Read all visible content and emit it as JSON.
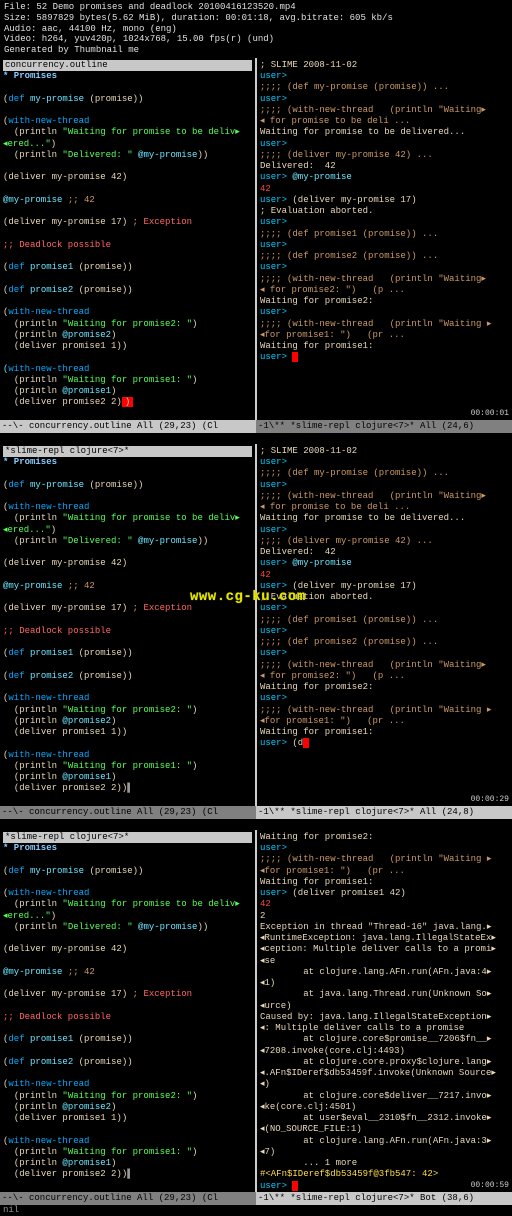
{
  "header": {
    "l1": "File: 52 Demo promises and deadlock 20100416123520.mp4",
    "l2": "Size: 5897829 bytes(5.62 MiB), duration: 00:01:18, avg.bitrate: 605 kb/s",
    "l3": "Audio: aac, 44100 Hz, mono (eng)",
    "l4": "Video: h264, yuv420p, 1024x768, 15.00 fps(r) (und)",
    "l5": "Generated by Thumbnail me"
  },
  "watermark": "www.cg-ku.com",
  "frame1": {
    "left_title": " concurrency.outline",
    "right_title": "; SLIME 2008-11-02",
    "left_mode": "--\\-   concurrency.outline   All (29,23)   (Cl",
    "right_mode": "-1\\**  *slime-repl clojure<7>*   All (24,6)",
    "right": {
      "l1": "user> ",
      "l2": ";;;; (def my-promise (promise)) ...",
      "l3": "user> ",
      "l4": ";;;; (with-new-thread   (println \"Waiting▸",
      "l5": "◂ for promise to be deli ...",
      "l6": "Waiting for promise to be delivered...",
      "l7": "user> ",
      "l8": ";;;; (deliver my-promise 42) ...",
      "l9": "Delivered:  42",
      "l10": "user> @my-promise",
      "l11": "42",
      "l12": "user> (deliver my-promise 17)",
      "l13": "; Evaluation aborted.",
      "l14": "user> ",
      "l15": ";;;; (def promise1 (promise)) ...",
      "l16": "user> ",
      "l17": ";;;; (def promise2 (promise)) ...",
      "l18": "user> ",
      "l19": ";;;; (with-new-thread   (println \"Waiting▸",
      "l20": "◂ for promise2: \")   (p ...",
      "l21": "Waiting for promise2: ",
      "l22": "user> ",
      "l23": ";;;; (with-new-thread   (println \"Waiting ▸",
      "l24": "◂for promise1: \")   (pr ...",
      "l25": "Waiting for promise1: ",
      "l26": "user> "
    },
    "ts": "00:00:01"
  },
  "frame2": {
    "left_title": " *slime-repl clojure<7>*",
    "ts": "00:00:29",
    "left_mode": "--\\-   concurrency.outline   All (29,23)   (Cl",
    "right_mode": "-1\\**  *slime-repl clojure<7>*   All (24,8)",
    "right": {
      "l26": "user> (d"
    }
  },
  "frame3": {
    "left_title": " *slime-repl clojure<7>*",
    "ts": "00:00:59",
    "left_mode": "--\\-   concurrency.outline   All (29,23)   (Cl",
    "right_mode": "-1\\**  *slime-repl clojure<7>*   Bot (38,6)",
    "right": {
      "l1": "Waiting for promise2: ",
      "l2": "user> ",
      "l3": ";;;; (with-new-thread   (println \"Waiting ▸",
      "l4": "◂for promise1: \")   (pr ...",
      "l5": "Waiting for promise1: ",
      "l6": "user> (deliver promise1 42)",
      "l7": "42",
      "l8": "2",
      "l9": "Exception in thread \"Thread-16\" java.lang.▸",
      "l10": "◂RuntimeException: java.lang.IllegalStateEx▸",
      "l11": "◂ception: Multiple deliver calls to a promi▸",
      "l12": "◂se",
      "l13": "        at clojure.lang.AFn.run(AFn.java:4▸",
      "l14": "◂1)",
      "l15": "        at java.lang.Thread.run(Unknown So▸",
      "l16": "◂urce)",
      "l17": "Caused by: java.lang.IllegalStateException▸",
      "l18": "◂: Multiple deliver calls to a promise",
      "l19": "        at clojure.core$promise__7206$fn__▸",
      "l20": "◂7208.invoke(core.clj:4493)",
      "l21": "        at clojure.core.proxy$clojure.lang▸",
      "l22": "◂.AFn$IDeref$db53459f.invoke(Unknown Source▸",
      "l23": "◂)",
      "l24": "        at clojure.core$deliver__7217.invo▸",
      "l25": "◂ke(core.clj:4501)",
      "l26": "        at user$eval__2310$fn__2312.invoke▸",
      "l27": "◂(NO_SOURCE_FILE:1)",
      "l28": "        at clojure.lang.AFn.run(AFn.java:3▸",
      "l29": "◂7)",
      "l30": "        ... 1 more",
      "l31": "#<AFn$IDeref$db53459f@3fb547: 42>",
      "l32": "user> "
    }
  },
  "left_code": {
    "heading": "* Promises",
    "l1": "(def my-promise (promise))",
    "l2": "(with-new-thread",
    "l3": "  (println \"Waiting for promise to be deliv▸",
    "l3b": "◂ered...\")",
    "l4": "  (println \"Delivered: \" @my-promise))",
    "l5": "(deliver my-promise 42)",
    "l6": "@my-promise ;; 42",
    "l7": "(deliver my-promise 17) ;",
    "l7b": "Exception",
    "l8": ";; Deadlock possible",
    "l9": "(def promise1 (promise))",
    "l10": "(def promise2 (promise))",
    "l11": "(with-new-thread",
    "l12": "  (println \"Waiting for promise2: \")",
    "l13": "  (println @promise2)",
    "l14": "  (deliver promise1 1))",
    "l15": "(with-new-thread",
    "l16": "  (println \"Waiting for promise1: \")",
    "l17": "  (println @promise1)",
    "l18": "  (deliver promise2 2))"
  }
}
